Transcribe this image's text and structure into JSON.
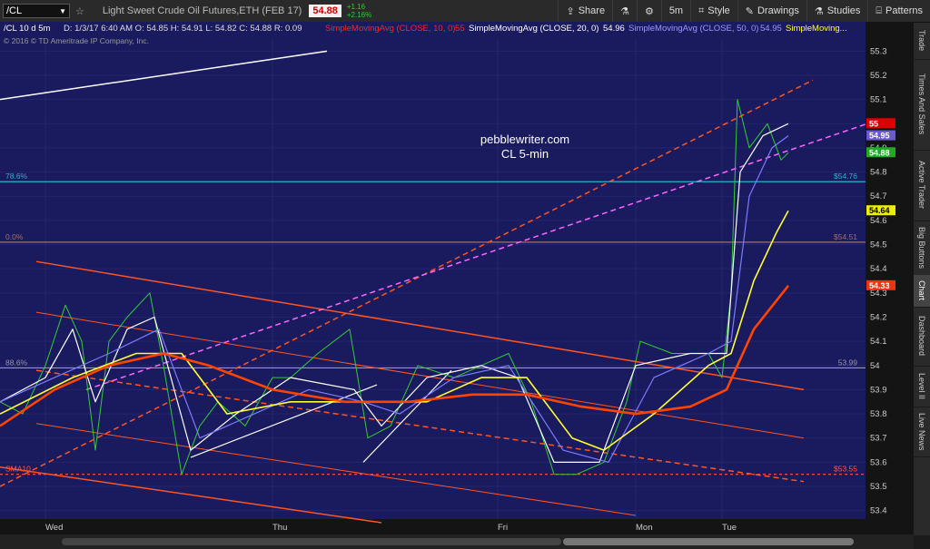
{
  "toolbar": {
    "symbol": "/CL",
    "description": "Light Sweet Crude Oil Futures,ETH (FEB 17)",
    "last": "54.88",
    "net_change": "+1.16",
    "pct_change": "+2.16%",
    "share": "Share",
    "timeframe": "5m",
    "style": "Style",
    "drawings": "Drawings",
    "studies": "Studies",
    "patterns": "Patterns"
  },
  "info_bar": {
    "header": "/CL 10 d 5m",
    "ohlc": "D: 1/3/17 6:40 AM  O: 54.85  H: 54.91  L: 54.82  C: 54.88  R: 0.09",
    "sma10": "SimpleMovingAvg (CLOSE, 10, 0)",
    "sma10_val": "55",
    "sma20": "SimpleMovingAvg (CLOSE, 20, 0)",
    "sma20_val": "54.96",
    "sma50": "SimpleMovingAvg (CLOSE, 50, 0)",
    "sma50_val": "54.95",
    "sma_more": "SimpleMoving...",
    "copyright": "© 2016 © TD Ameritrade IP Company, Inc."
  },
  "watermark": {
    "line1": "pebblewriter.com",
    "line2": "CL 5-min"
  },
  "sidebar_tabs": [
    "Trade",
    "Times And Sales",
    "Active Trader",
    "Big Buttons",
    "Chart",
    "Dashboard",
    "Level II",
    "Live News"
  ],
  "colors": {
    "background": "#1a1a5e",
    "sma10": "#ffffff",
    "sma20": "#7b7bff",
    "sma50": "#ffff33",
    "sma200": "#ff4400",
    "channel": "#ff5522",
    "trend_magenta": "#ff66ff"
  },
  "chart_data": {
    "type": "line",
    "ylim": [
      53.35,
      55.35
    ],
    "y_ticks": [
      "55.3",
      "55.2",
      "55.1",
      "55",
      "54.9",
      "54.8",
      "54.7",
      "54.6",
      "54.5",
      "54.4",
      "54.3",
      "54.2",
      "54.1",
      "54",
      "53.9",
      "53.8",
      "53.7",
      "53.6",
      "53.5",
      "53.4"
    ],
    "x_labels": [
      "Wed",
      "Thu",
      "Fri",
      "Mon",
      "Tue"
    ],
    "fib_levels": [
      {
        "label": "78.6%",
        "value": 54.76,
        "price_label": "$54.76"
      },
      {
        "label": "0.0%",
        "value": 54.51,
        "price_label": "$54.51"
      },
      {
        "label": "88.6%",
        "value": 53.99,
        "price_label": "53.99"
      },
      {
        "label": "SMA10",
        "value": 53.55,
        "price_label": "$53.55"
      }
    ],
    "price_badges": [
      {
        "text": "55",
        "value": 55.0,
        "color": "#dd0000"
      },
      {
        "text": "54.95",
        "value": 54.95,
        "color": "#6a5acd"
      },
      {
        "text": "54.88",
        "value": 54.88,
        "color": "#22aa22"
      },
      {
        "text": "54.64",
        "value": 54.64,
        "color": "#eeee00"
      },
      {
        "text": "54.33",
        "value": 54.33,
        "color": "#ee3311"
      }
    ],
    "series": [
      {
        "key": "price",
        "color": "#33cc33",
        "points": [
          [
            0,
            53.85
          ],
          [
            25,
            53.8
          ],
          [
            50,
            54.0
          ],
          [
            72,
            54.25
          ],
          [
            90,
            54.1
          ],
          [
            105,
            53.65
          ],
          [
            120,
            54.1
          ],
          [
            140,
            54.2
          ],
          [
            165,
            54.3
          ],
          [
            180,
            54.0
          ],
          [
            200,
            53.55
          ],
          [
            220,
            53.75
          ],
          [
            240,
            53.85
          ],
          [
            270,
            53.75
          ],
          [
            300,
            53.95
          ],
          [
            320,
            53.95
          ],
          [
            350,
            54.05
          ],
          [
            385,
            54.15
          ],
          [
            405,
            53.7
          ],
          [
            430,
            53.75
          ],
          [
            460,
            54.0
          ],
          [
            500,
            53.95
          ],
          [
            530,
            54.0
          ],
          [
            560,
            54.05
          ],
          [
            585,
            53.85
          ],
          [
            610,
            53.55
          ],
          [
            635,
            53.55
          ],
          [
            665,
            53.6
          ],
          [
            690,
            53.85
          ],
          [
            705,
            54.1
          ],
          [
            740,
            54.05
          ],
          [
            780,
            54.05
          ],
          [
            795,
            53.95
          ],
          [
            805,
            54.3
          ],
          [
            812,
            55.1
          ],
          [
            825,
            54.9
          ],
          [
            845,
            55.0
          ],
          [
            860,
            54.85
          ],
          [
            868,
            54.88
          ]
        ]
      },
      {
        "key": "sma10",
        "color": "#ffffff",
        "points": [
          [
            0,
            53.85
          ],
          [
            50,
            53.95
          ],
          [
            80,
            54.15
          ],
          [
            105,
            53.85
          ],
          [
            140,
            54.15
          ],
          [
            170,
            54.2
          ],
          [
            210,
            53.65
          ],
          [
            260,
            53.8
          ],
          [
            320,
            53.95
          ],
          [
            390,
            53.9
          ],
          [
            420,
            53.75
          ],
          [
            470,
            53.95
          ],
          [
            530,
            54.0
          ],
          [
            570,
            53.95
          ],
          [
            610,
            53.6
          ],
          [
            660,
            53.6
          ],
          [
            700,
            54.0
          ],
          [
            760,
            54.05
          ],
          [
            800,
            54.05
          ],
          [
            815,
            54.8
          ],
          [
            840,
            54.95
          ],
          [
            868,
            55.0
          ]
        ]
      },
      {
        "key": "sma20",
        "color": "#7b7bff",
        "points": [
          [
            0,
            53.85
          ],
          [
            60,
            53.95
          ],
          [
            120,
            54.05
          ],
          [
            175,
            54.15
          ],
          [
            220,
            53.7
          ],
          [
            280,
            53.8
          ],
          [
            340,
            53.9
          ],
          [
            400,
            53.85
          ],
          [
            440,
            53.8
          ],
          [
            500,
            53.95
          ],
          [
            560,
            54.0
          ],
          [
            620,
            53.65
          ],
          [
            670,
            53.6
          ],
          [
            720,
            53.95
          ],
          [
            780,
            54.05
          ],
          [
            805,
            54.1
          ],
          [
            825,
            54.7
          ],
          [
            850,
            54.9
          ],
          [
            868,
            54.95
          ]
        ]
      },
      {
        "key": "sma50",
        "color": "#ffff33",
        "points": [
          [
            0,
            53.8
          ],
          [
            80,
            53.95
          ],
          [
            150,
            54.05
          ],
          [
            200,
            54.05
          ],
          [
            250,
            53.8
          ],
          [
            320,
            53.85
          ],
          [
            400,
            53.85
          ],
          [
            470,
            53.85
          ],
          [
            530,
            53.95
          ],
          [
            580,
            53.95
          ],
          [
            630,
            53.7
          ],
          [
            665,
            53.65
          ],
          [
            720,
            53.8
          ],
          [
            780,
            54.0
          ],
          [
            805,
            54.05
          ],
          [
            830,
            54.35
          ],
          [
            855,
            54.55
          ],
          [
            868,
            54.64
          ]
        ]
      },
      {
        "key": "sma200",
        "color": "#ff4400",
        "points": [
          [
            0,
            53.75
          ],
          [
            60,
            53.9
          ],
          [
            120,
            54.0
          ],
          [
            180,
            54.05
          ],
          [
            230,
            54.0
          ],
          [
            300,
            53.9
          ],
          [
            380,
            53.85
          ],
          [
            450,
            53.85
          ],
          [
            520,
            53.88
          ],
          [
            580,
            53.88
          ],
          [
            640,
            53.83
          ],
          [
            700,
            53.8
          ],
          [
            760,
            53.83
          ],
          [
            800,
            53.9
          ],
          [
            830,
            54.15
          ],
          [
            868,
            54.33
          ]
        ]
      }
    ],
    "trendlines": [
      {
        "from": [
          0,
          55.1
        ],
        "to": [
          360,
          55.3
        ],
        "color": "#ffffff",
        "dash": false,
        "width": 1.5
      },
      {
        "from": [
          40,
          54.43
        ],
        "to": [
          885,
          53.9
        ],
        "color": "#ff5522",
        "dash": false,
        "width": 1.5
      },
      {
        "from": [
          40,
          54.22
        ],
        "to": [
          885,
          53.7
        ],
        "color": "#ff5522",
        "dash": false,
        "width": 1
      },
      {
        "from": [
          40,
          53.98
        ],
        "to": [
          885,
          53.52
        ],
        "color": "#ff5522",
        "dash": true,
        "width": 1.5
      },
      {
        "from": [
          40,
          53.76
        ],
        "to": [
          700,
          53.38
        ],
        "color": "#ff5522",
        "dash": false,
        "width": 1
      },
      {
        "from": [
          0,
          53.58
        ],
        "to": [
          420,
          53.35
        ],
        "color": "#ff5522",
        "dash": false,
        "width": 1.5
      },
      {
        "from": [
          0,
          53.5
        ],
        "to": [
          895,
          55.18
        ],
        "color": "#ff5522",
        "dash": true,
        "width": 1.5
      },
      {
        "from": [
          95,
          53.9
        ],
        "to": [
          955,
          55.0
        ],
        "color": "#ff66ff",
        "dash": true,
        "width": 1.5
      },
      {
        "from": [
          210,
          53.62
        ],
        "to": [
          415,
          53.92
        ],
        "color": "#ffffff",
        "dash": false,
        "width": 1.2
      },
      {
        "from": [
          400,
          53.6
        ],
        "to": [
          497,
          53.98
        ],
        "color": "#ffffff",
        "dash": false,
        "width": 1.2
      }
    ]
  }
}
